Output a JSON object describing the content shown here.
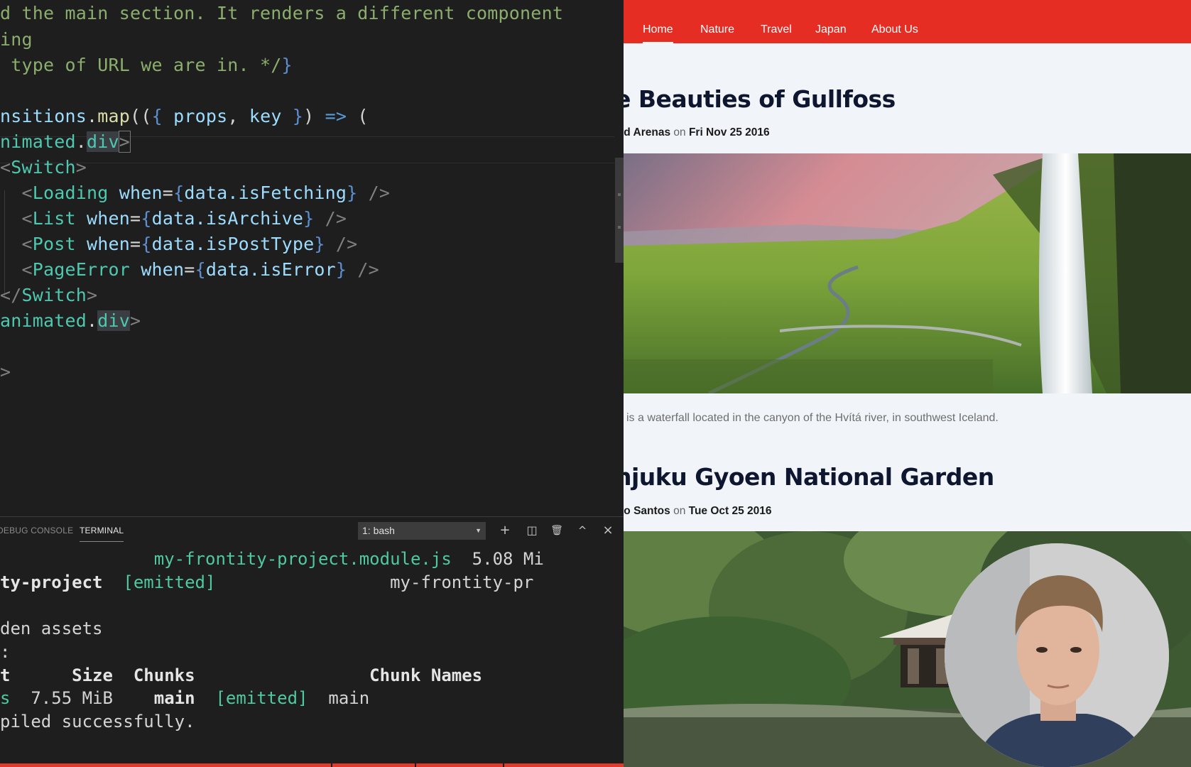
{
  "editor": {
    "lines": [
      {
        "segments": [
          {
            "t": "d the main section. It renders a different component",
            "c": "comment"
          }
        ]
      },
      {
        "segments": [
          {
            "t": "ing",
            "c": "comment"
          }
        ]
      },
      {
        "segments": [
          {
            "t": " type of URL we are in. */",
            "c": "comment"
          },
          {
            "t": "}",
            "c": "brace"
          }
        ]
      },
      {
        "segments": []
      },
      {
        "segments": [
          {
            "t": "nsitions",
            "c": "var"
          },
          {
            "t": ".",
            "c": "plain"
          },
          {
            "t": "map",
            "c": "fn"
          },
          {
            "t": "((",
            "c": "plain"
          },
          {
            "t": "{ ",
            "c": "brace"
          },
          {
            "t": "props",
            "c": "var"
          },
          {
            "t": ", ",
            "c": "plain"
          },
          {
            "t": "key",
            "c": "var"
          },
          {
            "t": " }",
            "c": "brace"
          },
          {
            "t": ") ",
            "c": "plain"
          },
          {
            "t": "=>",
            "c": "kw"
          },
          {
            "t": " (",
            "c": "plain"
          }
        ]
      },
      {
        "segments": [
          {
            "t": "nimated",
            "c": "tag"
          },
          {
            "t": ".",
            "c": "plain"
          },
          {
            "t": "div",
            "c": "tag",
            "hl": true
          },
          {
            "t": ">",
            "c": "punct",
            "match": true
          }
        ]
      },
      {
        "segments": [
          {
            "t": "<",
            "c": "punct"
          },
          {
            "t": "Switch",
            "c": "tag"
          },
          {
            "t": ">",
            "c": "punct"
          }
        ]
      },
      {
        "segments": [
          {
            "t": "  <",
            "c": "punct"
          },
          {
            "t": "Loading",
            "c": "tag"
          },
          {
            "t": " when",
            "c": "attr"
          },
          {
            "t": "=",
            "c": "plain"
          },
          {
            "t": "{",
            "c": "brace"
          },
          {
            "t": "data.isFetching",
            "c": "var"
          },
          {
            "t": "}",
            "c": "brace"
          },
          {
            "t": " />",
            "c": "punct"
          }
        ]
      },
      {
        "segments": [
          {
            "t": "  <",
            "c": "punct"
          },
          {
            "t": "List",
            "c": "tag"
          },
          {
            "t": " when",
            "c": "attr"
          },
          {
            "t": "=",
            "c": "plain"
          },
          {
            "t": "{",
            "c": "brace"
          },
          {
            "t": "data.isArchive",
            "c": "var"
          },
          {
            "t": "}",
            "c": "brace"
          },
          {
            "t": " />",
            "c": "punct"
          }
        ]
      },
      {
        "segments": [
          {
            "t": "  <",
            "c": "punct"
          },
          {
            "t": "Post",
            "c": "tag"
          },
          {
            "t": " when",
            "c": "attr"
          },
          {
            "t": "=",
            "c": "plain"
          },
          {
            "t": "{",
            "c": "brace"
          },
          {
            "t": "data.isPostType",
            "c": "var"
          },
          {
            "t": "}",
            "c": "brace"
          },
          {
            "t": " />",
            "c": "punct"
          }
        ]
      },
      {
        "segments": [
          {
            "t": "  <",
            "c": "punct"
          },
          {
            "t": "PageError",
            "c": "tag"
          },
          {
            "t": " when",
            "c": "attr"
          },
          {
            "t": "=",
            "c": "plain"
          },
          {
            "t": "{",
            "c": "brace"
          },
          {
            "t": "data.isError",
            "c": "var"
          },
          {
            "t": "}",
            "c": "brace"
          },
          {
            "t": " />",
            "c": "punct"
          }
        ]
      },
      {
        "segments": [
          {
            "t": "</",
            "c": "punct"
          },
          {
            "t": "Switch",
            "c": "tag"
          },
          {
            "t": ">",
            "c": "punct"
          }
        ]
      },
      {
        "segments": [
          {
            "t": "animated",
            "c": "tag"
          },
          {
            "t": ".",
            "c": "plain"
          },
          {
            "t": "div",
            "c": "tag",
            "hl": true
          },
          {
            "t": ">",
            "c": "punct"
          }
        ]
      },
      {
        "segments": []
      },
      {
        "segments": [
          {
            "t": ">",
            "c": "punct"
          }
        ]
      }
    ]
  },
  "panel": {
    "tabs": [
      {
        "label": "DEBUG CONSOLE",
        "active": false
      },
      {
        "label": "TERMINAL",
        "active": true
      }
    ],
    "terminal_select": "1: bash",
    "actions": [
      {
        "name": "new-terminal",
        "glyph": "+"
      },
      {
        "name": "split-terminal",
        "glyph": "◫"
      },
      {
        "name": "kill-terminal",
        "glyph": "🗑"
      },
      {
        "name": "maximize-panel",
        "glyph": "^"
      },
      {
        "name": "close-panel",
        "glyph": "×"
      }
    ],
    "terminal_lines": [
      {
        "segments": [
          {
            "t": "               ",
            "c": "plain"
          },
          {
            "t": "my-frontity-project.module.js",
            "c": "green"
          },
          {
            "t": "  5.08 Mi",
            "c": "plain"
          }
        ]
      },
      {
        "segments": [
          {
            "t": "ty-project",
            "c": "bold"
          },
          {
            "t": "  ",
            "c": "plain"
          },
          {
            "t": "[emitted]",
            "c": "green"
          },
          {
            "t": "                 my-frontity-pr",
            "c": "plain"
          }
        ]
      },
      {
        "segments": []
      },
      {
        "segments": [
          {
            "t": "den assets",
            "c": "plain"
          }
        ]
      },
      {
        "segments": [
          {
            "t": ":",
            "c": "plain"
          }
        ]
      },
      {
        "segments": [
          {
            "t": "t      Size  Chunks                 Chunk Names",
            "c": "bold"
          }
        ]
      },
      {
        "segments": [
          {
            "t": "s",
            "c": "green"
          },
          {
            "t": "  7.55 MiB    ",
            "c": "plain"
          },
          {
            "t": "main",
            "c": "bold"
          },
          {
            "t": "  ",
            "c": "plain"
          },
          {
            "t": "[emitted]",
            "c": "green"
          },
          {
            "t": "  main",
            "c": "plain"
          }
        ]
      },
      {
        "segments": [
          {
            "t": "piled successfully.",
            "c": "plain"
          }
        ]
      }
    ]
  },
  "site": {
    "brand_color": "#e52d24",
    "nav": [
      {
        "label": "Home",
        "active": true
      },
      {
        "label": "Nature",
        "active": false
      },
      {
        "label": "Travel",
        "active": false
      },
      {
        "label": "Japan",
        "active": false
      },
      {
        "label": "About Us",
        "active": false
      }
    ],
    "posts": [
      {
        "title": "e Beauties of Gullfoss",
        "author": "id Arenas",
        "on": "on",
        "date": "Fri Nov 25 2016",
        "image": "waterfall-landscape",
        "excerpt": "is a waterfall located in the canyon of the Hvítá river, in southwest Iceland."
      },
      {
        "title": "njuku Gyoen National Garden",
        "author": "io Santos",
        "on": "on",
        "date": "Tue Oct 25 2016",
        "image": "japanese-garden-pavilion"
      }
    ]
  },
  "webcam": {
    "label": "presenter-webcam"
  }
}
